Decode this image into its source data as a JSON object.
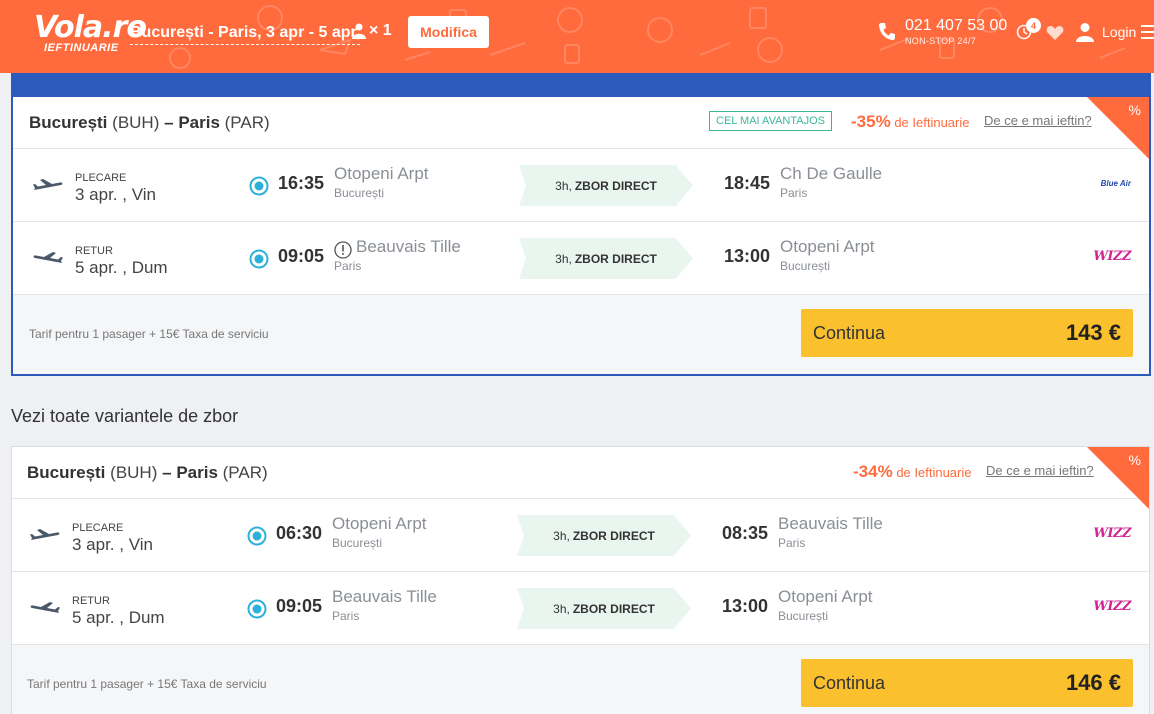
{
  "header": {
    "brand": "Vola.ro",
    "brand_sub": "IEFTINUARIE",
    "search_summary": "București - Paris, 3 apr - 5 apr,",
    "pax": "× 1",
    "modify_label": "Modifica",
    "phone": "021 407 53 00",
    "phone_sub": "NON-STOP 24/7",
    "history_count": "4",
    "login_label": "Login",
    "accent_color": "#ff6b3d"
  },
  "section_title": "Vezi toate variantele de zbor",
  "offers": [
    {
      "origin_city": "București",
      "origin_code": "(BUH)",
      "dest_city": "Paris",
      "dest_code": "(PAR)",
      "dash": "–",
      "badge": "CEL MAI AVANTAJOS",
      "discount_pct": "-35%",
      "discount_text": "de Ieftinuarie",
      "why_link": "De ce e mai ieftin?",
      "corner_label": "%",
      "legs": [
        {
          "label": "PLECARE",
          "date": "3 apr. , Vin",
          "dep_time": "16:35",
          "dep_airport": "Otopeni Arpt",
          "dep_city": "București",
          "duration": "3h,",
          "direct": "ZBOR DIRECT",
          "arr_time": "18:45",
          "arr_airport": "Ch De Gaulle",
          "arr_city": "Paris",
          "airline": "Blue Air",
          "warning": false
        },
        {
          "label": "RETUR",
          "date": "5 apr. , Dum",
          "dep_time": "09:05",
          "dep_airport": "Beauvais Tille",
          "dep_city": "Paris",
          "duration": "3h,",
          "direct": "ZBOR DIRECT",
          "arr_time": "13:00",
          "arr_airport": "Otopeni Arpt",
          "arr_city": "București",
          "airline": "WIZZ",
          "warning": true
        }
      ],
      "tarif": "Tarif pentru 1 pasager + 15€ Taxa de serviciu",
      "continue_label": "Continua",
      "price": "143 €"
    },
    {
      "origin_city": "București",
      "origin_code": "(BUH)",
      "dest_city": "Paris",
      "dest_code": "(PAR)",
      "dash": "–",
      "discount_pct": "-34%",
      "discount_text": "de Ieftinuarie",
      "why_link": "De ce e mai ieftin?",
      "corner_label": "%",
      "legs": [
        {
          "label": "PLECARE",
          "date": "3 apr. , Vin",
          "dep_time": "06:30",
          "dep_airport": "Otopeni Arpt",
          "dep_city": "București",
          "duration": "3h,",
          "direct": "ZBOR DIRECT",
          "arr_time": "08:35",
          "arr_airport": "Beauvais Tille",
          "arr_city": "Paris",
          "airline": "WIZZ",
          "warning": false
        },
        {
          "label": "RETUR",
          "date": "5 apr. , Dum",
          "dep_time": "09:05",
          "dep_airport": "Beauvais Tille",
          "dep_city": "Paris",
          "duration": "3h,",
          "direct": "ZBOR DIRECT",
          "arr_time": "13:00",
          "arr_airport": "Otopeni Arpt",
          "arr_city": "București",
          "airline": "WIZZ",
          "warning": false
        }
      ],
      "tarif": "Tarif pentru 1 pasager + 15€ Taxa de serviciu",
      "continue_label": "Continua",
      "price": "146 €"
    }
  ]
}
